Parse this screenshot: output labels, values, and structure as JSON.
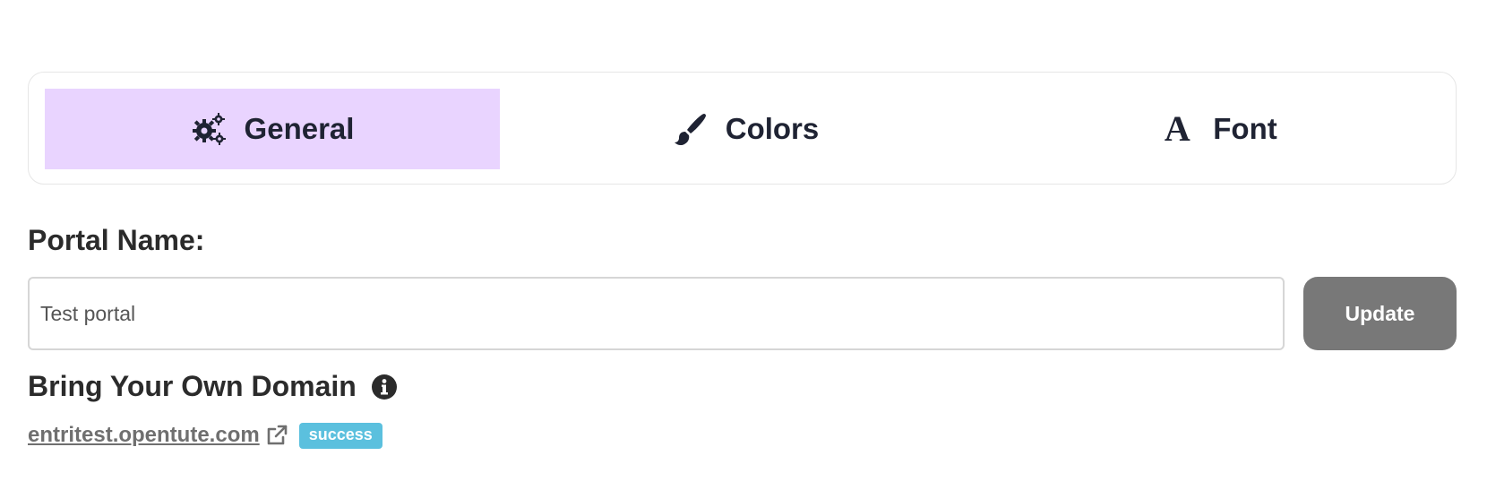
{
  "tabs": [
    {
      "label": "General",
      "icon": "gears-icon",
      "active": true
    },
    {
      "label": "Colors",
      "icon": "paintbrush-icon",
      "active": false
    },
    {
      "label": "Font",
      "icon": "font-icon",
      "glyph": "A",
      "active": false
    }
  ],
  "portal": {
    "label": "Portal Name:",
    "value": "Test portal",
    "update_label": "Update"
  },
  "byod": {
    "title": "Bring Your Own Domain",
    "info_icon": "info-circle-icon",
    "domain": "entritest.opentute.com",
    "link_icon": "external-link-icon",
    "status": "success"
  },
  "colors": {
    "active_tab_bg": "#e9d4ff",
    "update_button_bg": "#787878",
    "success_badge": "#5bc0de",
    "text_dark": "#1f2333"
  }
}
